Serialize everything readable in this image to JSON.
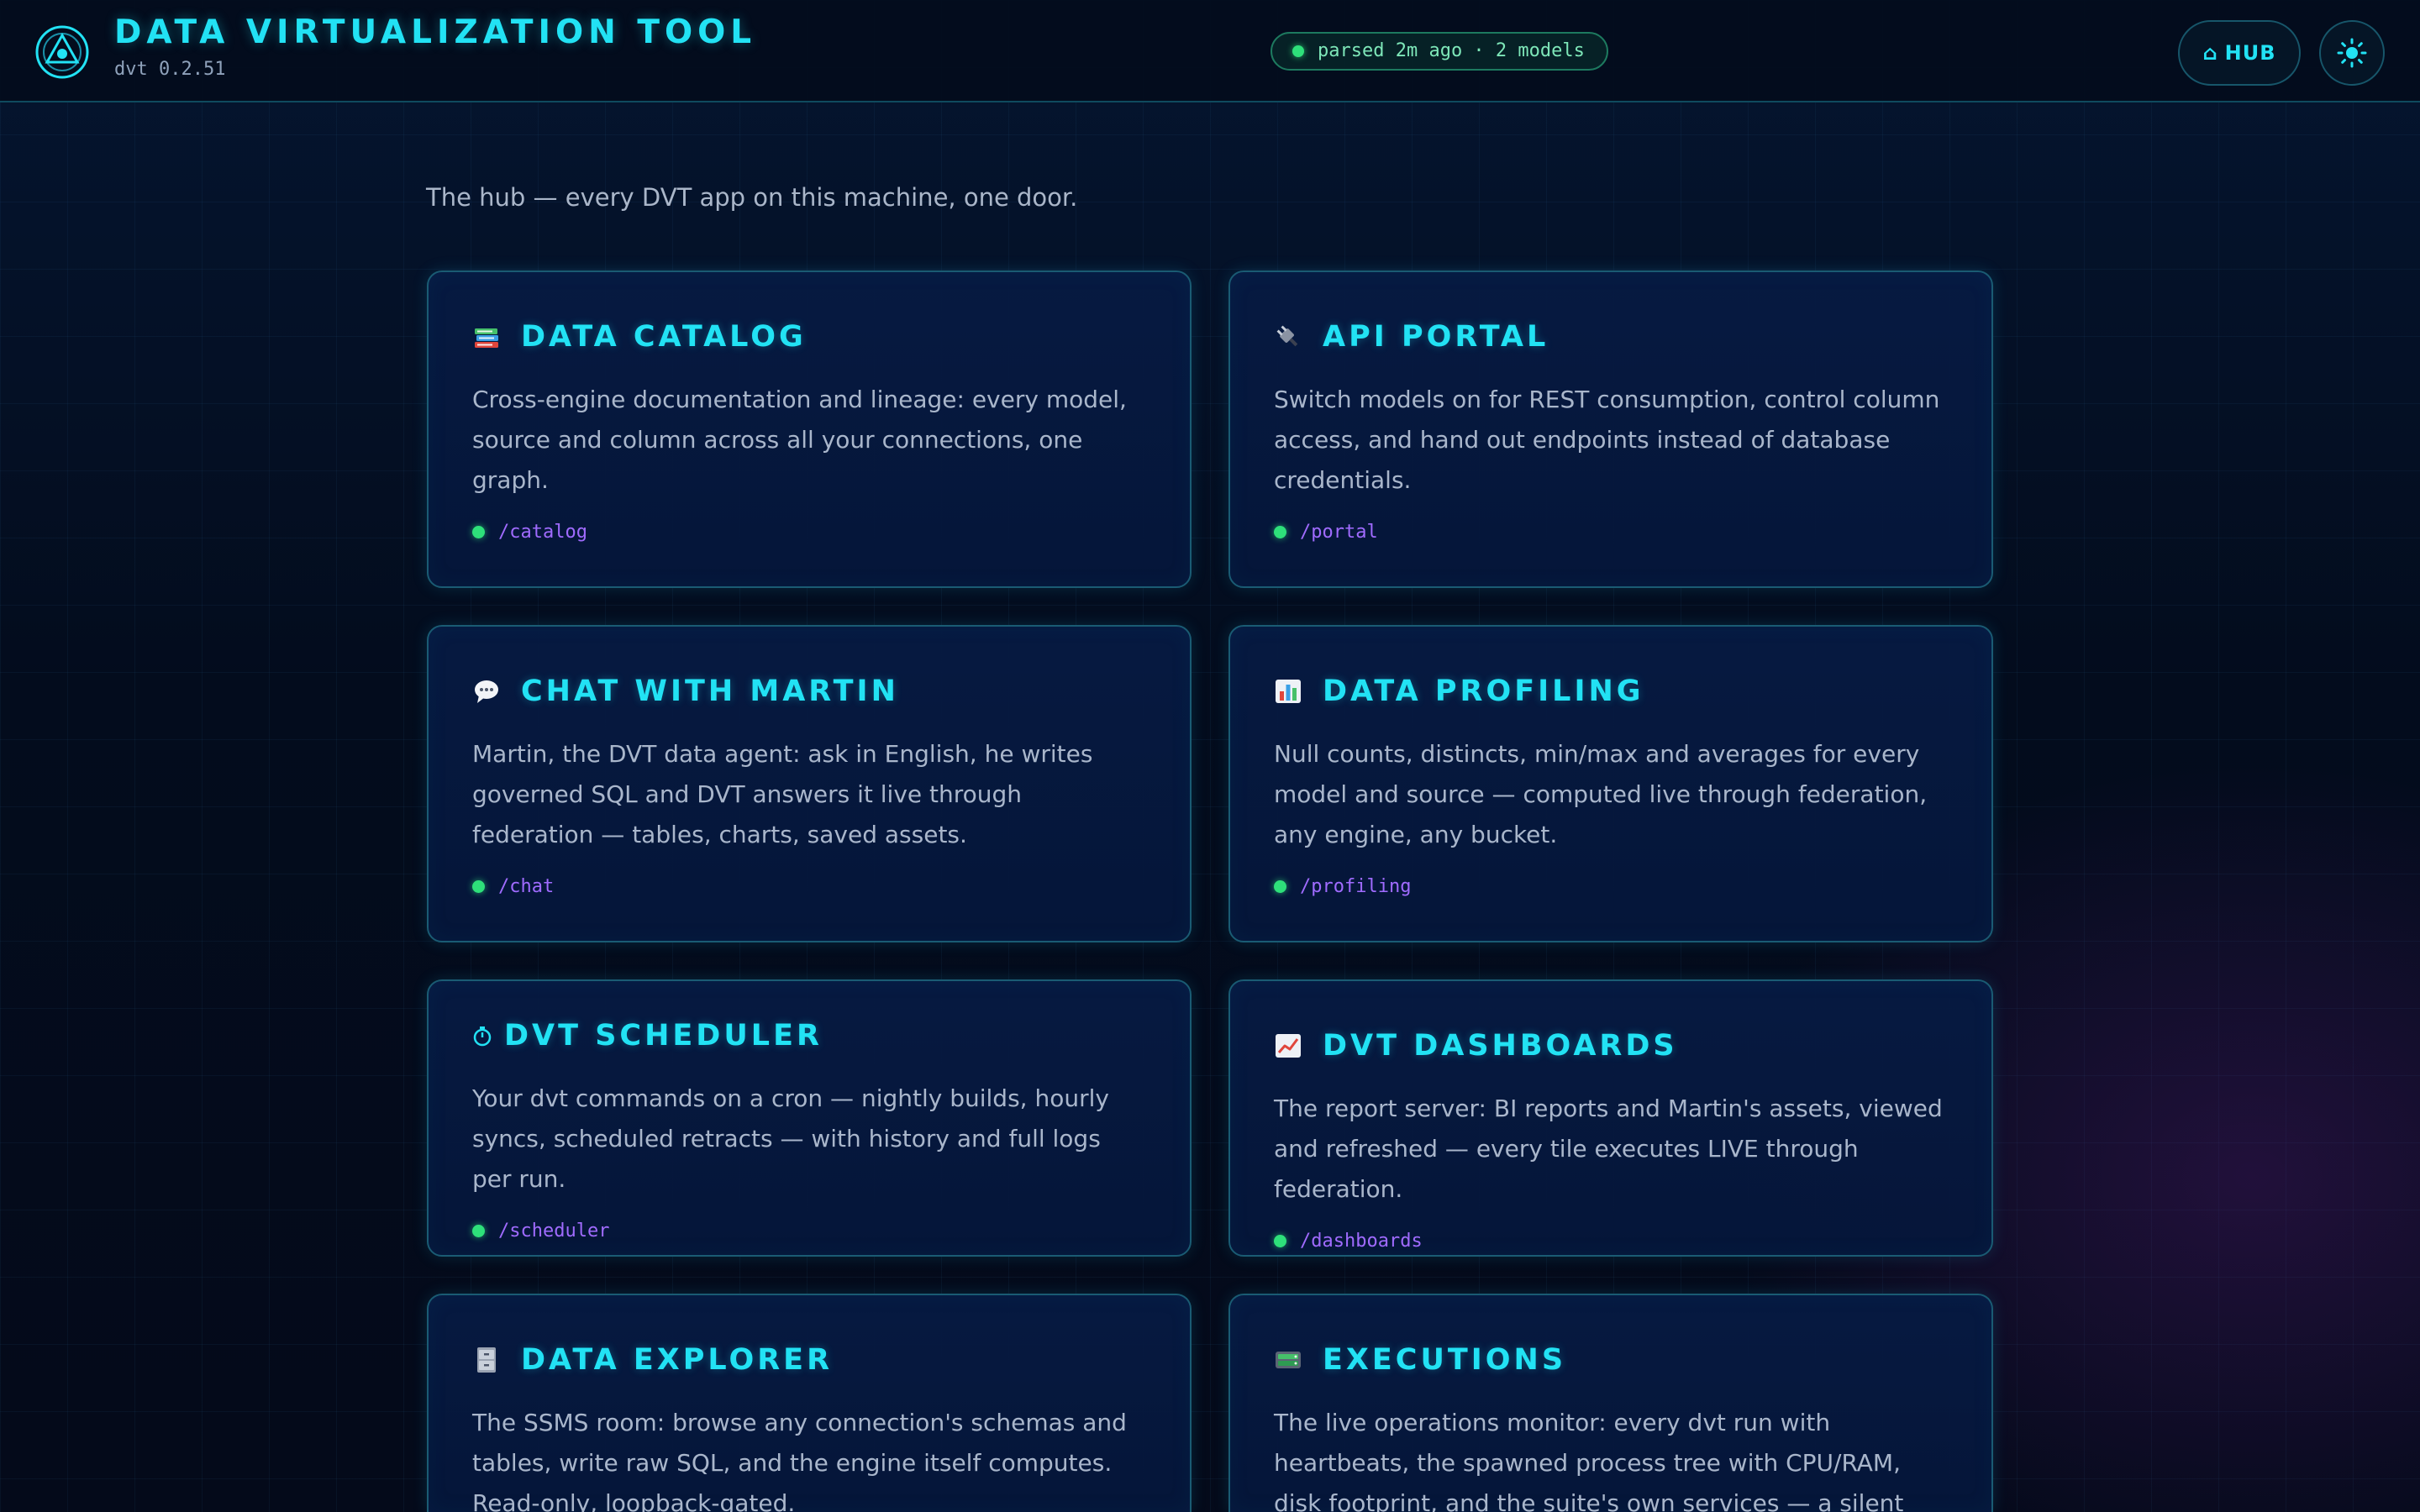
{
  "header": {
    "title": "DATA VIRTUALIZATION TOOL",
    "version": "dvt 0.2.51",
    "status": "parsed 2m ago · 2 models",
    "hub_label": "HUB"
  },
  "intro": "The hub — every DVT app on this machine, one door.",
  "cards": [
    {
      "icon": "books-icon",
      "title": "DATA CATALOG",
      "description": "Cross-engine documentation and lineage: every model, source and column across all your connections, one graph.",
      "route": "/catalog"
    },
    {
      "icon": "plug-icon",
      "title": "API PORTAL",
      "description": "Switch models on for REST consumption, control column access, and hand out endpoints instead of database credentials.",
      "route": "/portal"
    },
    {
      "icon": "speech-bubble-icon",
      "title": "CHAT WITH MARTIN",
      "description": "Martin, the DVT data agent: ask in English, he writes governed SQL and DVT answers it live through federation — tables, charts, saved assets.",
      "route": "/chat"
    },
    {
      "icon": "bar-chart-icon",
      "title": "DATA PROFILING",
      "description": "Null counts, distincts, min/max and averages for every model and source — computed live through federation, any engine, any bucket.",
      "route": "/profiling"
    },
    {
      "icon": "stopwatch-icon",
      "title": "DVT SCHEDULER",
      "description": "Your dvt commands on a cron — nightly builds, hourly syncs, scheduled retracts — with history and full logs per run.",
      "route": "/scheduler"
    },
    {
      "icon": "trend-chart-icon",
      "title": "DVT DASHBOARDS",
      "description": "The report server: BI reports and Martin's assets, viewed and refreshed — every tile executes LIVE through federation.",
      "route": "/dashboards"
    },
    {
      "icon": "file-cabinet-icon",
      "title": "DATA EXPLORER",
      "description": "The SSMS room: browse any connection's schemas and tables, write raw SQL, and the engine itself computes. Read-only, loopback-gated.",
      "route": ""
    },
    {
      "icon": "server-icon",
      "title": "EXECUTIONS",
      "description": "The live operations monitor: every dvt run with heartbeats, the spawned process tree with CPU/RAM, disk footprint, and the suite's own services — a silent death is impossible to",
      "route": ""
    }
  ],
  "colors": {
    "accent": "#22e2f4",
    "status_green": "#2ee07a",
    "route_purple": "#a06bff",
    "background": "#030c1c"
  }
}
